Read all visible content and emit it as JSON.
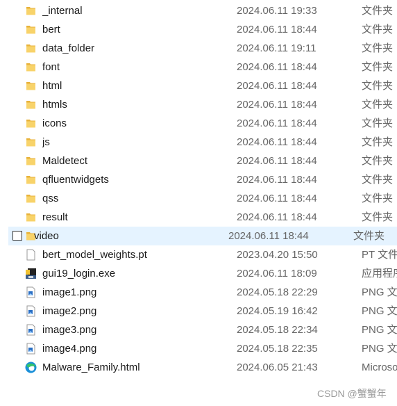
{
  "files": [
    {
      "name": "_internal",
      "date": "2024.06.11 19:33",
      "type": "文件夹",
      "icon": "folder-icon"
    },
    {
      "name": "bert",
      "date": "2024.06.11 18:44",
      "type": "文件夹",
      "icon": "folder-icon"
    },
    {
      "name": "data_folder",
      "date": "2024.06.11 19:11",
      "type": "文件夹",
      "icon": "folder-icon"
    },
    {
      "name": "font",
      "date": "2024.06.11 18:44",
      "type": "文件夹",
      "icon": "folder-icon"
    },
    {
      "name": "html",
      "date": "2024.06.11 18:44",
      "type": "文件夹",
      "icon": "folder-icon"
    },
    {
      "name": "htmls",
      "date": "2024.06.11 18:44",
      "type": "文件夹",
      "icon": "folder-icon"
    },
    {
      "name": "icons",
      "date": "2024.06.11 18:44",
      "type": "文件夹",
      "icon": "folder-icon"
    },
    {
      "name": "js",
      "date": "2024.06.11 18:44",
      "type": "文件夹",
      "icon": "folder-icon"
    },
    {
      "name": "Maldetect",
      "date": "2024.06.11 18:44",
      "type": "文件夹",
      "icon": "folder-icon"
    },
    {
      "name": "qfluentwidgets",
      "date": "2024.06.11 18:44",
      "type": "文件夹",
      "icon": "folder-icon"
    },
    {
      "name": "qss",
      "date": "2024.06.11 18:44",
      "type": "文件夹",
      "icon": "folder-icon"
    },
    {
      "name": "result",
      "date": "2024.06.11 18:44",
      "type": "文件夹",
      "icon": "folder-icon"
    },
    {
      "name": "video",
      "date": "2024.06.11 18:44",
      "type": "文件夹",
      "icon": "folder-icon",
      "selected": true
    },
    {
      "name": "bert_model_weights.pt",
      "date": "2023.04.20 15:50",
      "type": "PT 文件",
      "icon": "file-icon"
    },
    {
      "name": "gui19_login.exe",
      "date": "2024.06.11 18:09",
      "type": "应用程序",
      "icon": "exe-icon"
    },
    {
      "name": "image1.png",
      "date": "2024.05.18 22:29",
      "type": "PNG 文件",
      "icon": "image-file-icon"
    },
    {
      "name": "image2.png",
      "date": "2024.05.19 16:42",
      "type": "PNG 文件",
      "icon": "image-file-icon"
    },
    {
      "name": "image3.png",
      "date": "2024.05.18 22:34",
      "type": "PNG 文件",
      "icon": "image-file-icon"
    },
    {
      "name": "image4.png",
      "date": "2024.05.18 22:35",
      "type": "PNG 文件",
      "icon": "image-file-icon"
    },
    {
      "name": "Malware_Family.html",
      "date": "2024.06.05 21:43",
      "type": "Microsoft Edge HTML Document",
      "icon": "edge-icon"
    }
  ],
  "watermark": "CSDN @蟹蟹年",
  "colors": {
    "selection": "#e5f3ff",
    "folder": "#f8c94a"
  }
}
